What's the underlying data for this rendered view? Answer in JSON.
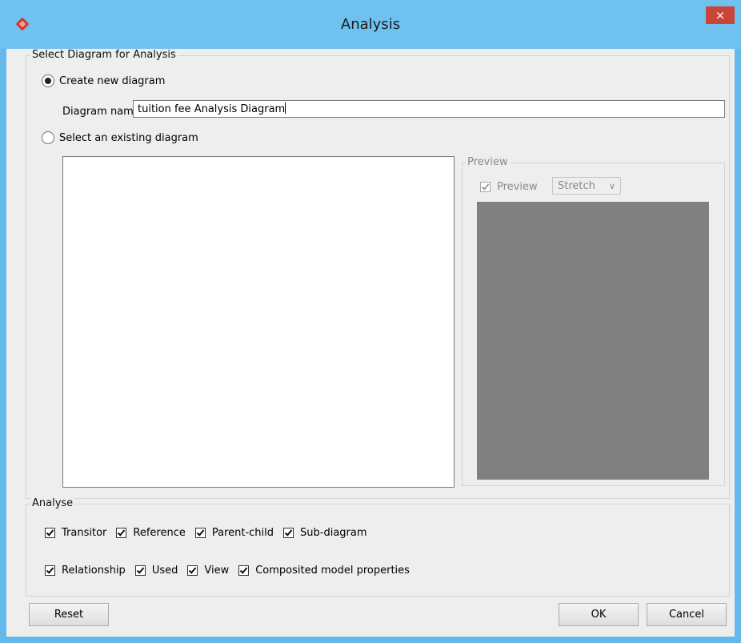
{
  "window": {
    "title": "Analysis",
    "close_glyph": "×"
  },
  "diagram_group": {
    "label": "Select Diagram for Analysis",
    "create_new_label": "Create new diagram",
    "create_new_selected": true,
    "name_label": "Diagram name:",
    "name_value": "tuition fee Analysis Diagram",
    "select_existing_label": "Select an existing diagram",
    "select_existing_selected": false
  },
  "preview_group": {
    "label": "Preview",
    "checkbox_label": "Preview",
    "checkbox_checked": true,
    "mode_value": "Stretch",
    "chevron": "∨"
  },
  "analyse_group": {
    "label": "Analyse",
    "row1": [
      {
        "label": "Transitor",
        "checked": true
      },
      {
        "label": "Reference",
        "checked": true
      },
      {
        "label": "Parent-child",
        "checked": true
      },
      {
        "label": "Sub-diagram",
        "checked": true
      }
    ],
    "row2": [
      {
        "label": "Relationship",
        "checked": true
      },
      {
        "label": "Used",
        "checked": true
      },
      {
        "label": "View",
        "checked": true
      },
      {
        "label": "Composited model properties",
        "checked": true
      }
    ]
  },
  "buttons": {
    "reset": "Reset",
    "ok": "OK",
    "cancel": "Cancel"
  },
  "colors": {
    "titlebar": "#6fc1f0",
    "close": "#c9453a",
    "preview_fill": "#808080"
  }
}
